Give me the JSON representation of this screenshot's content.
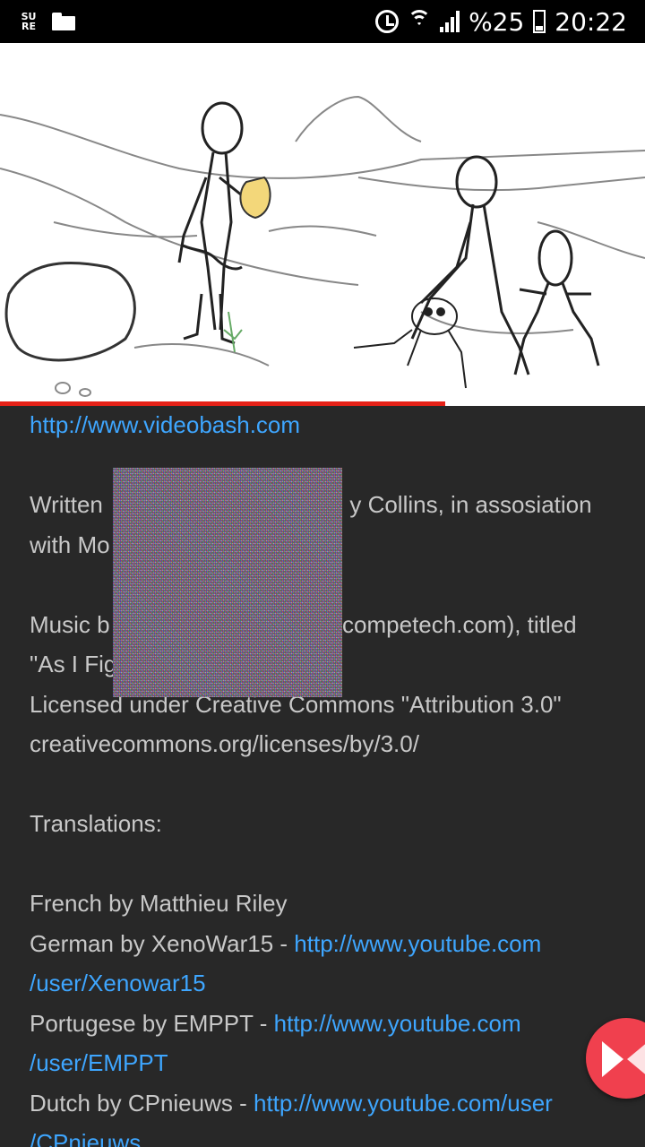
{
  "status_bar": {
    "sure_label": "SURE",
    "battery_text": "%25",
    "time": "20:22"
  },
  "video": {
    "progress": 0.69
  },
  "description": {
    "link1": "http://www.videobash.com",
    "line_written_1a": "Written",
    "line_written_1b": "y Collins, in assosiation",
    "line_written_2": "with Mo",
    "line_music_1a": "Music b",
    "line_music_1b": "competech.com), titled",
    "line_music_2": "\"As I Fig",
    "line_license": "Licensed under Creative Commons \"Attribution 3.0\"",
    "line_license_url": "creativecommons.org/licenses/by/3.0/",
    "translations_heading": "Translations:",
    "french": "French by Matthieu Riley",
    "german_prefix": "German by XenoWar15 - ",
    "german_link_1": "http://www.youtube.com",
    "german_link_2": "/user/Xenowar15",
    "portugese_prefix": "Portugese by EMPPT - ",
    "portugese_link_1": "http://www.youtube.com",
    "portugese_link_2": "/user/EMPPT",
    "dutch_prefix": "Dutch by CPnieuws - ",
    "dutch_link_1": "http://www.youtube.com/user",
    "dutch_link_2": "/CPnieuws"
  },
  "colors": {
    "background": "#282828",
    "link": "#3ea6ff",
    "text": "#c8c8c8",
    "progress": "#e62117",
    "fab": "#f0404e"
  }
}
